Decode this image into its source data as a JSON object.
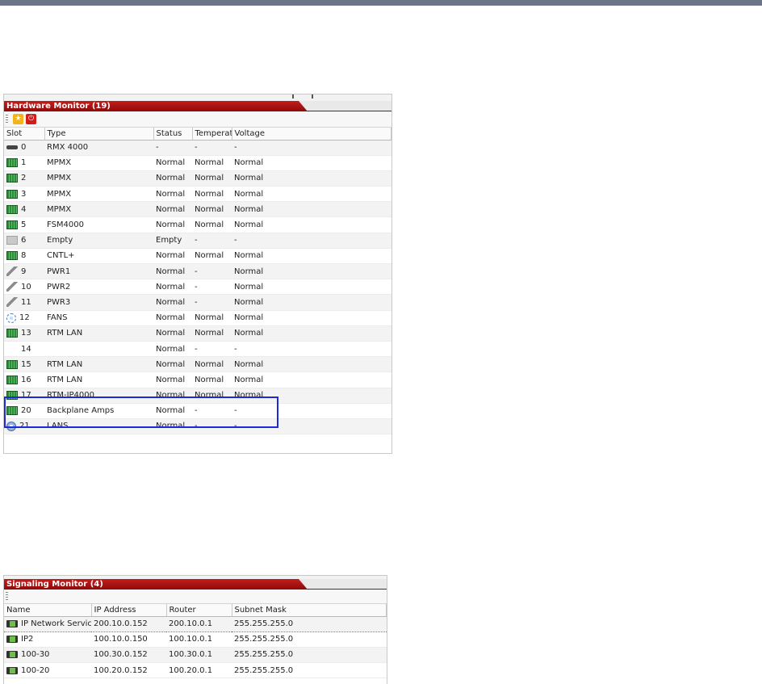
{
  "hardware_monitor": {
    "title": "Hardware Monitor (19)",
    "toolbar": {
      "star_icon": "star-icon",
      "power_icon": "power-icon",
      "power_glyph": "⏻",
      "star_glyph": "★"
    },
    "columns": [
      "Slot",
      "Type",
      "Status",
      "Temperat",
      "Voltage"
    ],
    "rows": [
      {
        "slot": "0",
        "icon": "chassis",
        "type": "RMX 4000",
        "status": "-",
        "temperature": "-",
        "voltage": "-"
      },
      {
        "slot": "1",
        "icon": "card",
        "type": "MPMX",
        "status": "Normal",
        "temperature": "Normal",
        "voltage": "Normal"
      },
      {
        "slot": "2",
        "icon": "card",
        "type": "MPMX",
        "status": "Normal",
        "temperature": "Normal",
        "voltage": "Normal"
      },
      {
        "slot": "3",
        "icon": "card",
        "type": "MPMX",
        "status": "Normal",
        "temperature": "Normal",
        "voltage": "Normal"
      },
      {
        "slot": "4",
        "icon": "card",
        "type": "MPMX",
        "status": "Normal",
        "temperature": "Normal",
        "voltage": "Normal"
      },
      {
        "slot": "5",
        "icon": "card",
        "type": "FSM4000",
        "status": "Normal",
        "temperature": "Normal",
        "voltage": "Normal"
      },
      {
        "slot": "6",
        "icon": "empty",
        "type": "Empty",
        "status": "Empty",
        "temperature": "-",
        "voltage": "-"
      },
      {
        "slot": "8",
        "icon": "card",
        "type": "CNTL+",
        "status": "Normal",
        "temperature": "Normal",
        "voltage": "Normal"
      },
      {
        "slot": "9",
        "icon": "plug",
        "type": "PWR1",
        "status": "Normal",
        "temperature": "-",
        "voltage": "Normal"
      },
      {
        "slot": "10",
        "icon": "plug",
        "type": "PWR2",
        "status": "Normal",
        "temperature": "-",
        "voltage": "Normal"
      },
      {
        "slot": "11",
        "icon": "plug",
        "type": "PWR3",
        "status": "Normal",
        "temperature": "-",
        "voltage": "Normal"
      },
      {
        "slot": "12",
        "icon": "fan",
        "type": "FANS",
        "status": "Normal",
        "temperature": "Normal",
        "voltage": "Normal"
      },
      {
        "slot": "13",
        "icon": "card",
        "type": "RTM LAN",
        "status": "Normal",
        "temperature": "Normal",
        "voltage": "Normal"
      },
      {
        "slot": "14",
        "icon": "none",
        "type": "",
        "status": "Normal",
        "temperature": "-",
        "voltage": "-"
      },
      {
        "slot": "15",
        "icon": "card",
        "type": "RTM LAN",
        "status": "Normal",
        "temperature": "Normal",
        "voltage": "Normal"
      },
      {
        "slot": "16",
        "icon": "card",
        "type": "RTM LAN",
        "status": "Normal",
        "temperature": "Normal",
        "voltage": "Normal"
      },
      {
        "slot": "17",
        "icon": "card",
        "type": "RTM-IP4000",
        "status": "Normal",
        "temperature": "Normal",
        "voltage": "Normal"
      },
      {
        "slot": "20",
        "icon": "card",
        "type": "Backplane Amps",
        "status": "Normal",
        "temperature": "-",
        "voltage": "-"
      },
      {
        "slot": "21",
        "icon": "lans",
        "type": "LANS",
        "status": "Normal",
        "temperature": "-",
        "voltage": "-"
      }
    ]
  },
  "signaling_monitor": {
    "title": "Signaling Monitor (4)",
    "columns": [
      "Name",
      "IP Address",
      "Router",
      "Subnet Mask"
    ],
    "rows": [
      {
        "name": "IP Network Servic",
        "ip": "200.10.0.152",
        "router": "200.10.0.1",
        "mask": "255.255.255.0",
        "selected": true
      },
      {
        "name": "IP2",
        "ip": "100.10.0.150",
        "router": "100.10.0.1",
        "mask": "255.255.255.0",
        "selected": false
      },
      {
        "name": "100-30",
        "ip": "100.30.0.152",
        "router": "100.30.0.1",
        "mask": "255.255.255.0",
        "selected": false
      },
      {
        "name": "100-20",
        "ip": "100.20.0.152",
        "router": "100.20.0.1",
        "mask": "255.255.255.0",
        "selected": false
      }
    ]
  },
  "colors": {
    "title_red": "#b01515",
    "highlight_blue": "#1d2ad8",
    "topbar": "#6b7585"
  }
}
